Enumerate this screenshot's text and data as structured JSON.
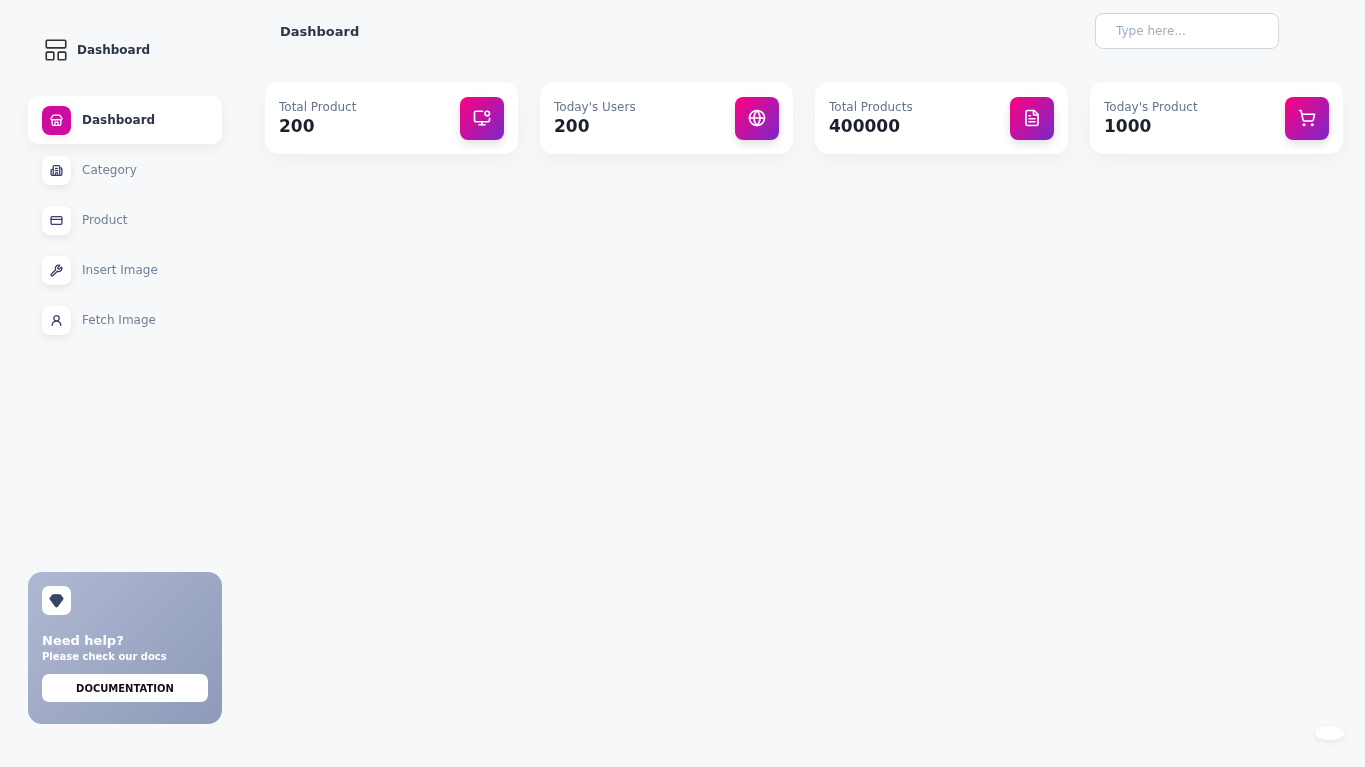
{
  "brand": {
    "title": "Dashboard"
  },
  "sidebar": {
    "items": [
      {
        "label": "Dashboard",
        "selected": true
      },
      {
        "label": "Category",
        "selected": false
      },
      {
        "label": "Product",
        "selected": false
      },
      {
        "label": "Insert Image",
        "selected": false
      },
      {
        "label": "Fetch Image",
        "selected": false
      }
    ]
  },
  "help": {
    "title": "Need help?",
    "subtitle": "Please check our docs",
    "button": "DOCUMENTATION"
  },
  "header": {
    "title": "Dashboard",
    "search": {
      "placeholder": "Type here..."
    }
  },
  "stats": [
    {
      "label": "Total Product",
      "value": "200"
    },
    {
      "label": "Today's Users",
      "value": "200"
    },
    {
      "label": "Total Products",
      "value": "400000"
    },
    {
      "label": "Today's Product",
      "value": "1000"
    }
  ]
}
